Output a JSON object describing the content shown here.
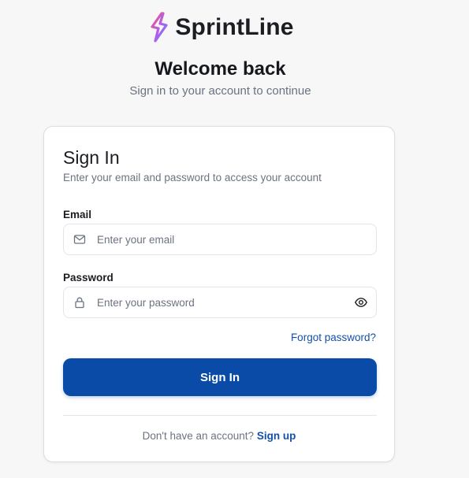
{
  "brand": {
    "name": "SprintLine",
    "logo_icon": "lightning-bolt-icon",
    "logo_colors": [
      "#f05a78",
      "#b15cf0",
      "#5b8cf5"
    ]
  },
  "header": {
    "title": "Welcome back",
    "subtitle": "Sign in to your account to continue"
  },
  "card": {
    "title": "Sign In",
    "description": "Enter your email and password to access your account",
    "email": {
      "label": "Email",
      "placeholder": "Enter your email",
      "value": "",
      "icon": "mail-icon"
    },
    "password": {
      "label": "Password",
      "placeholder": "Enter your password",
      "value": "",
      "icon": "lock-icon",
      "toggle_icon": "eye-icon"
    },
    "forgot_label": "Forgot password?",
    "submit_label": "Sign In",
    "signup_prompt": "Don't have an account?",
    "signup_label": "Sign up"
  },
  "colors": {
    "primary": "#0a4ba8",
    "link": "#1550a8",
    "muted_text": "#6b7280",
    "background": "#f7f7f8"
  }
}
